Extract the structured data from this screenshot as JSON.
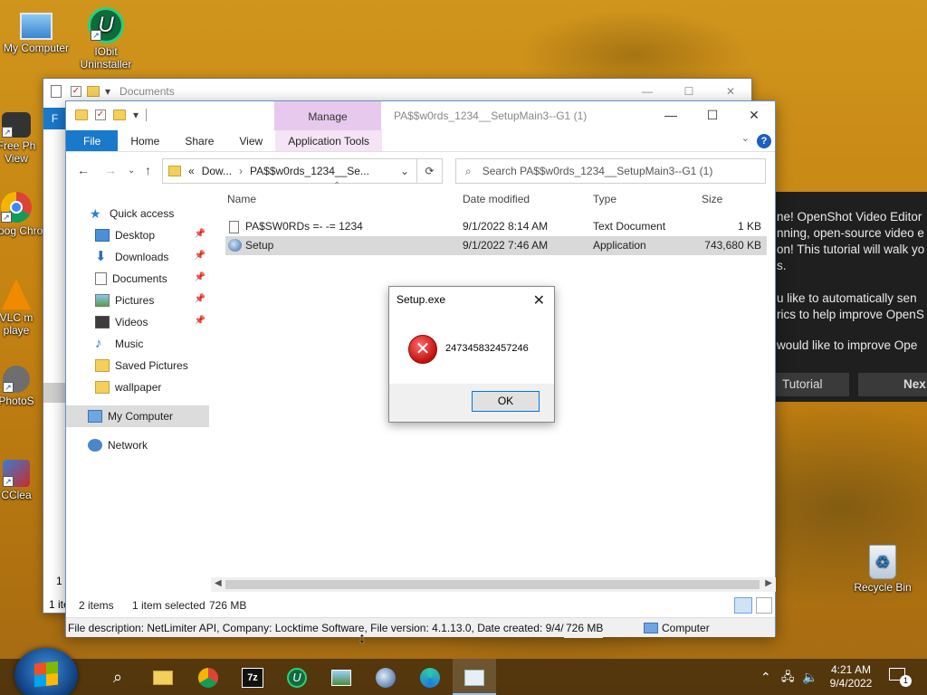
{
  "desktop": {
    "icons": [
      {
        "label": "My Computer"
      },
      {
        "label": "IObit Uninstaller"
      },
      {
        "label": "Free Ph View"
      },
      {
        "label": "Goog Chro"
      },
      {
        "label": "VLC m playe"
      },
      {
        "label": "PhotoS"
      },
      {
        "label": "CClea"
      },
      {
        "label": "Recycle Bin"
      }
    ]
  },
  "back_window": {
    "title": "Documents",
    "status_partial_1": "1 i",
    "status_partial_2": "1 ite",
    "ribbon_partial": "F"
  },
  "explorer": {
    "title": "PA$$w0rds_1234__SetupMain3--G1 (1)",
    "manage_tab": "Manage",
    "ribbon_tabs": {
      "file": "File",
      "home": "Home",
      "share": "Share",
      "view": "View",
      "app_tools": "Application Tools"
    },
    "address": {
      "prefix": "«",
      "crumb1": "Dow...",
      "crumb2": "PA$$w0rds_1234__Se..."
    },
    "search_placeholder": "Search PA$$w0rds_1234__SetupMain3--G1 (1)",
    "nav": {
      "quick_access": "Quick access",
      "items": [
        {
          "label": "Desktop",
          "pinned": true
        },
        {
          "label": "Downloads",
          "pinned": true
        },
        {
          "label": "Documents",
          "pinned": true
        },
        {
          "label": "Pictures",
          "pinned": true
        },
        {
          "label": "Videos",
          "pinned": true
        },
        {
          "label": "Music",
          "pinned": false
        },
        {
          "label": "Saved Pictures",
          "pinned": false
        },
        {
          "label": "wallpaper",
          "pinned": false
        }
      ],
      "my_computer": "My Computer",
      "network": "Network"
    },
    "columns": {
      "name": "Name",
      "date": "Date modified",
      "type": "Type",
      "size": "Size"
    },
    "files": [
      {
        "name": "PA$SW0RDs =- -= 1234",
        "date": "9/1/2022 8:14 AM",
        "type": "Text Document",
        "size": "1 KB"
      },
      {
        "name": "Setup",
        "date": "9/1/2022 7:46 AM",
        "type": "Application",
        "size": "743,680 KB"
      }
    ],
    "status": {
      "items": "2 items",
      "selected": "1 item selected",
      "size": "726 MB"
    },
    "tooltip_bar": {
      "description": "File description: NetLimiter API, Company: Locktime Software, File version: 4.1.13.0, Date created: 9/4/2",
      "size": "726 MB",
      "location": "Computer"
    }
  },
  "dialog": {
    "title": "Setup.exe",
    "message": "247345832457246",
    "ok_label": "OK"
  },
  "openshot": {
    "lines": [
      "ne! OpenShot Video Editor",
      "nning, open-source video e",
      "on! This tutorial will walk yo",
      "s.",
      "",
      "u like to automatically sen",
      "rics to help improve OpenS",
      "",
      "would like to improve Ope"
    ],
    "tutorial_btn": "Tutorial",
    "next_btn": "Nex"
  },
  "taskbar": {
    "time": "4:21 AM",
    "date": "9/4/2022",
    "notifications": "1"
  }
}
